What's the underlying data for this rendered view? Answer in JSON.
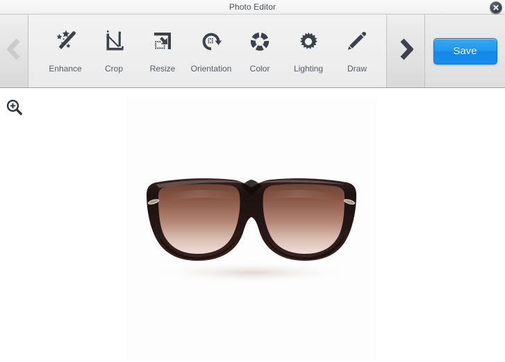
{
  "window": {
    "title": "Photo Editor",
    "close_label": "X",
    "close_icon": "close-x-icon"
  },
  "toolbar": {
    "prev_arrow": {
      "icon": "chevron-left-icon",
      "enabled": false
    },
    "next_arrow": {
      "icon": "chevron-right-icon",
      "enabled": true
    },
    "tools": [
      {
        "label": "Enhance",
        "icon": "magic-wand-icon"
      },
      {
        "label": "Crop",
        "icon": "crop-icon"
      },
      {
        "label": "Resize",
        "icon": "resize-icon"
      },
      {
        "label": "Orientation",
        "icon": "rotate-icon"
      },
      {
        "label": "Color",
        "icon": "color-wheel-icon"
      },
      {
        "label": "Lighting",
        "icon": "sun-icon"
      },
      {
        "label": "Draw",
        "icon": "pencil-icon"
      }
    ],
    "save_label": "Save"
  },
  "left_rail": {
    "items": [
      {
        "icon": "zoom-in-magnifier-icon",
        "label": "Zoom"
      }
    ]
  },
  "canvas": {
    "photo_alt": "Sunglasses with dark frames and brown gradient lenses",
    "background": "#ffffff",
    "photo_background": "#fdfdfd"
  },
  "colors": {
    "accent": "#2196ef",
    "icon_dark": "#3c424b",
    "label_text": "#565b63",
    "title_text": "#4a4f57",
    "toolbar_bg": "#eeeeee",
    "strip_bg": "#e3e3e3",
    "disabled_arrow": "#c9c9c9",
    "frame_dark": "#241715",
    "lens_brown": "#8a5a46"
  }
}
